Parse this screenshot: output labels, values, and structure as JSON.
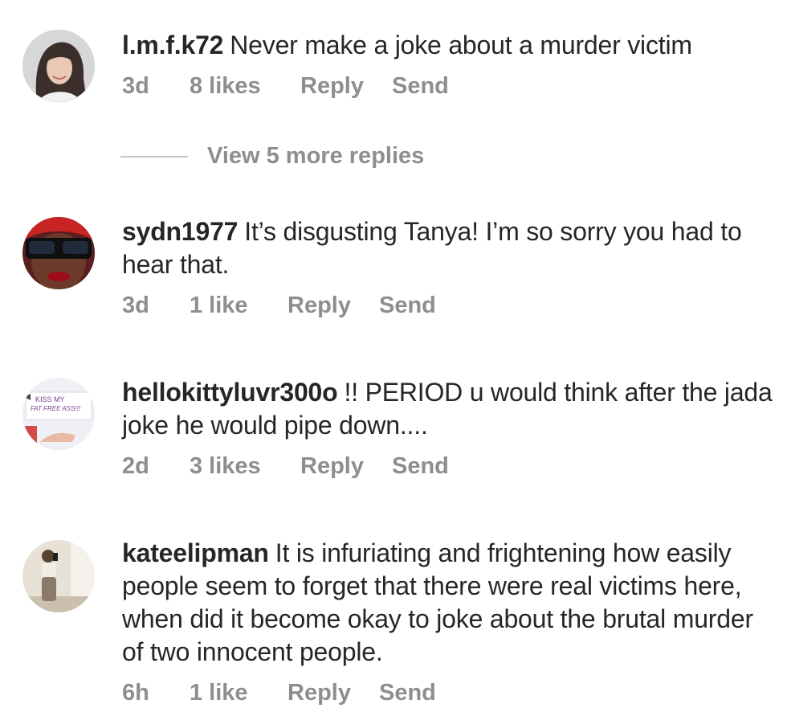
{
  "comments": [
    {
      "username": "l.m.f.k72",
      "text": "Never make a joke about a murder victim",
      "time": "3d",
      "likes": "8 likes",
      "reply_label": "Reply",
      "send_label": "Send",
      "avatar_icon": "profile-photo-woman"
    },
    {
      "username": "sydn1977",
      "text": "It’s disgusting Tanya! I’m so sorry you had to hear that.",
      "time": "3d",
      "likes": "1 like",
      "reply_label": "Reply",
      "send_label": "Send",
      "avatar_icon": "profile-photo-sunglasses"
    },
    {
      "username": "hellokittyluvr300o",
      "text": "!! PERIOD u would think after the jada joke he would pipe down....",
      "time": "2d",
      "likes": "3 likes",
      "reply_label": "Reply",
      "send_label": "Send",
      "avatar_icon": "profile-photo-sign",
      "avatar_text": "KISS MY FAT FREE ASS!!!"
    },
    {
      "username": "kateelipman",
      "text": "It is infuriating and frightening how easily people seem to forget that there were real victims here, when did it become okay to joke about the brutal murder of two innocent people.",
      "time": "6h",
      "likes": "1 like",
      "reply_label": "Reply",
      "send_label": "Send",
      "avatar_icon": "profile-photo-mirror-selfie"
    }
  ],
  "view_more_replies": "View 5 more replies",
  "colors": {
    "text": "#262626",
    "meta": "#8e8e8e",
    "divider": "#c7c7c7"
  }
}
